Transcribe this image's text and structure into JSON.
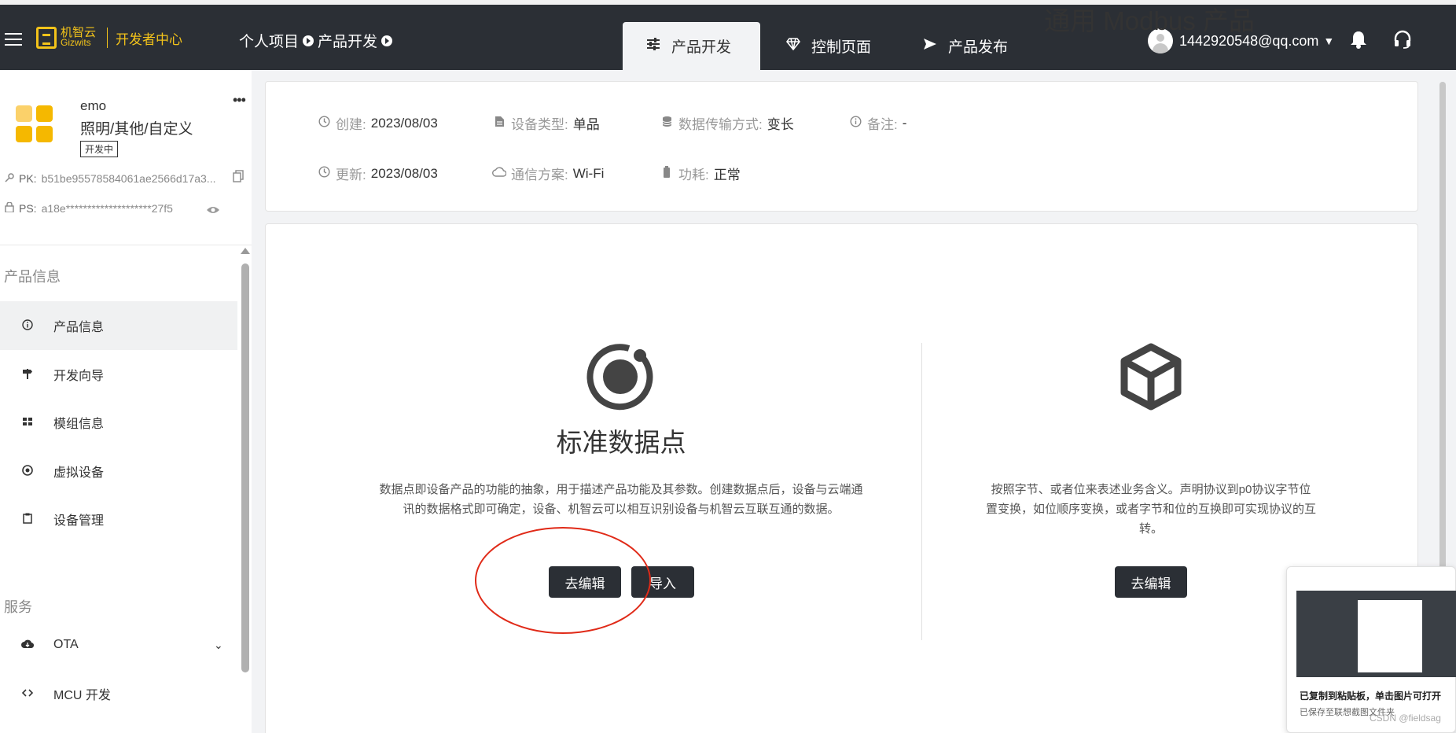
{
  "header": {
    "logo_cn": "机智云",
    "logo_en": "Gizwits",
    "logo_sub": "开发者中心",
    "breadcrumb": [
      "个人项目",
      "产品开发"
    ],
    "tabs": [
      {
        "label": "产品开发",
        "icon": "sliders-icon"
      },
      {
        "label": "控制页面",
        "icon": "diamond-icon"
      },
      {
        "label": "产品发布",
        "icon": "send-icon"
      }
    ],
    "user_email": "1442920548@qq.com"
  },
  "product": {
    "name": "emo",
    "category": "照明/其他/自定义",
    "status": "开发中",
    "pk_label": "PK:",
    "pk_value": "b51be95578584061ae2566d17a3...",
    "ps_label": "PS:",
    "ps_value": "a18e********************27f5"
  },
  "sidebar": {
    "section1": "产品信息",
    "items": [
      {
        "label": "产品信息",
        "icon": "info-icon"
      },
      {
        "label": "开发向导",
        "icon": "signpost-icon"
      },
      {
        "label": "模组信息",
        "icon": "grid-icon"
      },
      {
        "label": "虚拟设备",
        "icon": "virtual-device-icon"
      },
      {
        "label": "设备管理",
        "icon": "clipboard-icon"
      }
    ],
    "section2": "服务",
    "items2": [
      {
        "label": "OTA",
        "icon": "cloud-download-icon"
      },
      {
        "label": "MCU 开发",
        "icon": "code-icon"
      }
    ]
  },
  "info": {
    "created_label": "创建:",
    "created_value": "2023/08/03",
    "device_type_label": "设备类型:",
    "device_type_value": "单品",
    "transfer_label": "数据传输方式:",
    "transfer_value": "变长",
    "note_label": "备注:",
    "note_value": "-",
    "updated_label": "更新:",
    "updated_value": "2023/08/03",
    "comm_label": "通信方案:",
    "comm_value": "Wi-Fi",
    "power_label": "功耗:",
    "power_value": "正常"
  },
  "options": {
    "standard": {
      "title": "标准数据点",
      "desc": "数据点即设备产品的功能的抽象，用于描述产品功能及其参数。创建数据点后，设备与云端通讯的数据格式即可确定，设备、机智云可以相互识别设备与机智云互联互通的数据。",
      "edit_btn": "去编辑",
      "import_btn": "导入"
    },
    "modbus": {
      "title": "通用 Modbus 产品",
      "desc": "按照字节、或者位来表述业务含义。声明协议到p0协议字节位置变换，如位顺序变换，或者字节和位的互换即可实现协议的互转。",
      "edit_btn": "去编辑"
    }
  },
  "toast": {
    "line1": "已复制到粘贴板，单击图片可打开",
    "line2": "已保存至联想截图文件夹"
  },
  "watermark": "CSDN @fieldsag",
  "colors": {
    "topbar": "#2b2f35",
    "accent": "#f3c31a",
    "button": "#2b2f35",
    "annotation": "#e02a18"
  }
}
